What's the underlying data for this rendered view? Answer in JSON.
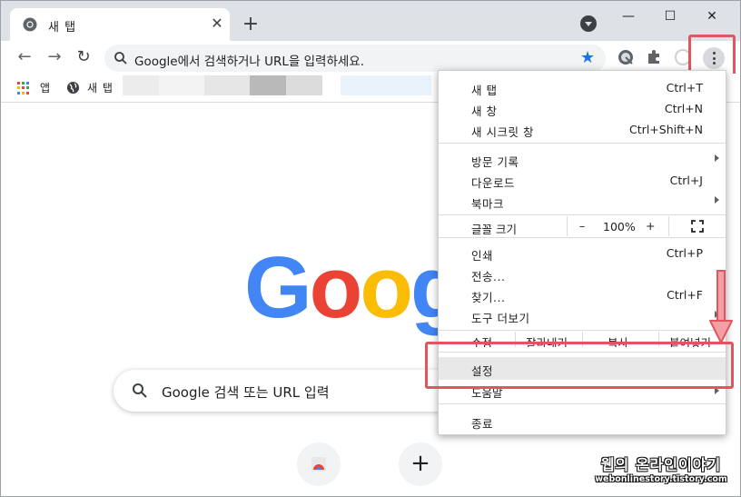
{
  "tab": {
    "title": "새 탭",
    "close": "✕"
  },
  "titlebar": {
    "new_tab": "+",
    "minimize": "—",
    "maximize": "☐",
    "close": "✕"
  },
  "toolbar": {
    "back": "←",
    "forward": "→",
    "reload": "↻",
    "omnibox_placeholder": "Google에서 검색하거나 URL을 입력하세요.",
    "star": "★"
  },
  "bookmarks": {
    "apps_label": "앱",
    "newtab_label": "새 탭"
  },
  "google": {
    "logo_letters": [
      "G",
      "o",
      "o",
      "g"
    ],
    "logo_colors": [
      "#4285F4",
      "#EA4335",
      "#FBBC05",
      "#4285F4"
    ],
    "search_placeholder": "Google 검색 또는 URL 입력",
    "add_shortcut": "+"
  },
  "menu": {
    "group1": [
      {
        "label": "새 탭",
        "shortcut": "Ctrl+T"
      },
      {
        "label": "새 창",
        "shortcut": "Ctrl+N"
      },
      {
        "label": "새 시크릿 창",
        "shortcut": "Ctrl+Shift+N"
      }
    ],
    "group2": [
      {
        "label": "방문 기록",
        "shortcut": ""
      },
      {
        "label": "다운로드",
        "shortcut": "Ctrl+J"
      },
      {
        "label": "북마크",
        "shortcut": ""
      }
    ],
    "zoom": {
      "label": "글꼴 크기",
      "minus": "–",
      "value": "100%",
      "plus": "+"
    },
    "group3": [
      {
        "label": "인쇄",
        "shortcut": "Ctrl+P"
      },
      {
        "label": "전송...",
        "shortcut": ""
      },
      {
        "label": "찾기...",
        "shortcut": "Ctrl+F"
      },
      {
        "label": "도구 더보기",
        "shortcut": ""
      }
    ],
    "edit": {
      "label": "수정",
      "cut": "잘라내기",
      "copy": "복사",
      "paste": "붙여넣기"
    },
    "settings": "설정",
    "help": "도움말",
    "exit": "종료"
  },
  "watermark": {
    "title": "웹의 온라인이야기",
    "url": "webonlinestory.tistory.com"
  },
  "colors": {
    "highlight": "#e05560",
    "accent": "#1a73e8"
  }
}
